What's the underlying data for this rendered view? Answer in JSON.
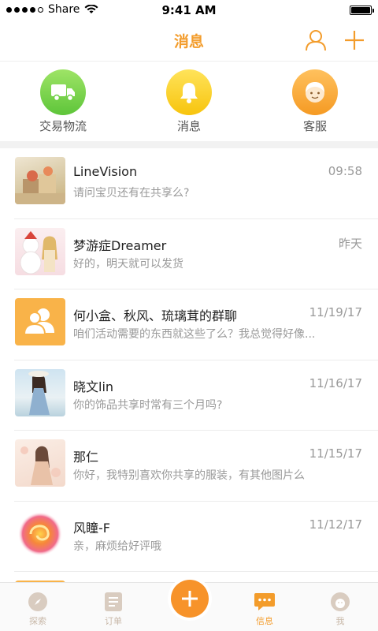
{
  "status": {
    "carrier": "Share",
    "time": "9:41 AM"
  },
  "nav": {
    "title": "消息"
  },
  "quick": [
    {
      "label": "交易物流",
      "icon": "truck-icon"
    },
    {
      "label": "消息",
      "icon": "bell-icon"
    },
    {
      "label": "客服",
      "icon": "customer-service-icon"
    }
  ],
  "messages": [
    {
      "name": "LineVision",
      "time": "09:58",
      "msg": "请问宝贝还有在共享么?"
    },
    {
      "name": "梦游症Dreamer",
      "time": "昨天",
      "msg": "好的，明天就可以发货"
    },
    {
      "name": "何小盒、秋风、琉璃茸的群聊",
      "time": "11/19/17",
      "msg": "咱们活动需要的东西就这些了么？我总觉得好像..."
    },
    {
      "name": "晓文lin",
      "time": "11/16/17",
      "msg": "你的饰品共享时常有三个月吗?"
    },
    {
      "name": "那仁",
      "time": "11/15/17",
      "msg": "你好，我特别喜欢你共享的服装，有其他图片么"
    },
    {
      "name": "风瞳-F",
      "time": "11/12/17",
      "msg": "亲，麻烦给好评哦"
    }
  ],
  "tabs": [
    {
      "label": "探索",
      "icon": "compass-icon"
    },
    {
      "label": "订单",
      "icon": "order-icon"
    },
    {
      "label": "",
      "icon": "plus-icon"
    },
    {
      "label": "信息",
      "icon": "message-icon"
    },
    {
      "label": "我",
      "icon": "profile-icon"
    }
  ],
  "colors": {
    "accent": "#f39c2b",
    "green": "#6fd045",
    "yellow": "#fbd125",
    "orange": "#f9a93b"
  }
}
